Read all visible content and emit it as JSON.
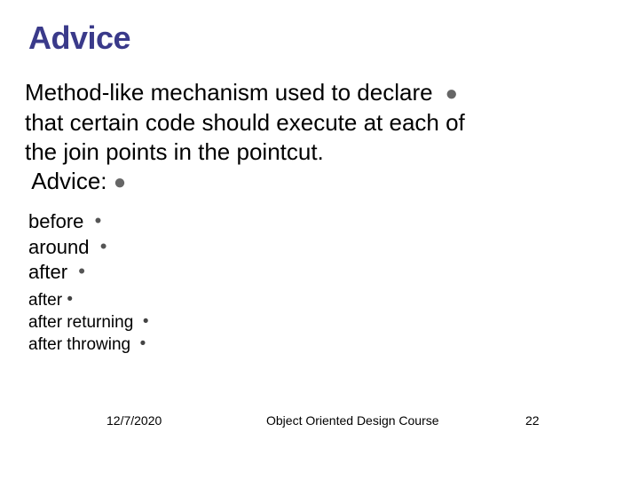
{
  "title": "Advice",
  "main": {
    "line1": "Method-like mechanism used to declare",
    "line2": "that certain code should execute at each of",
    "line3": " the join points in the pointcut.",
    "advice_label": "Advice:"
  },
  "sub1": {
    "item1": "before",
    "item2": "around",
    "item3": "after"
  },
  "sub2": {
    "item1": "after",
    "item2": "after returning",
    "item3": "after throwing"
  },
  "footer": {
    "date": "12/7/2020",
    "course": "Object Oriented Design Course",
    "page": "22"
  }
}
